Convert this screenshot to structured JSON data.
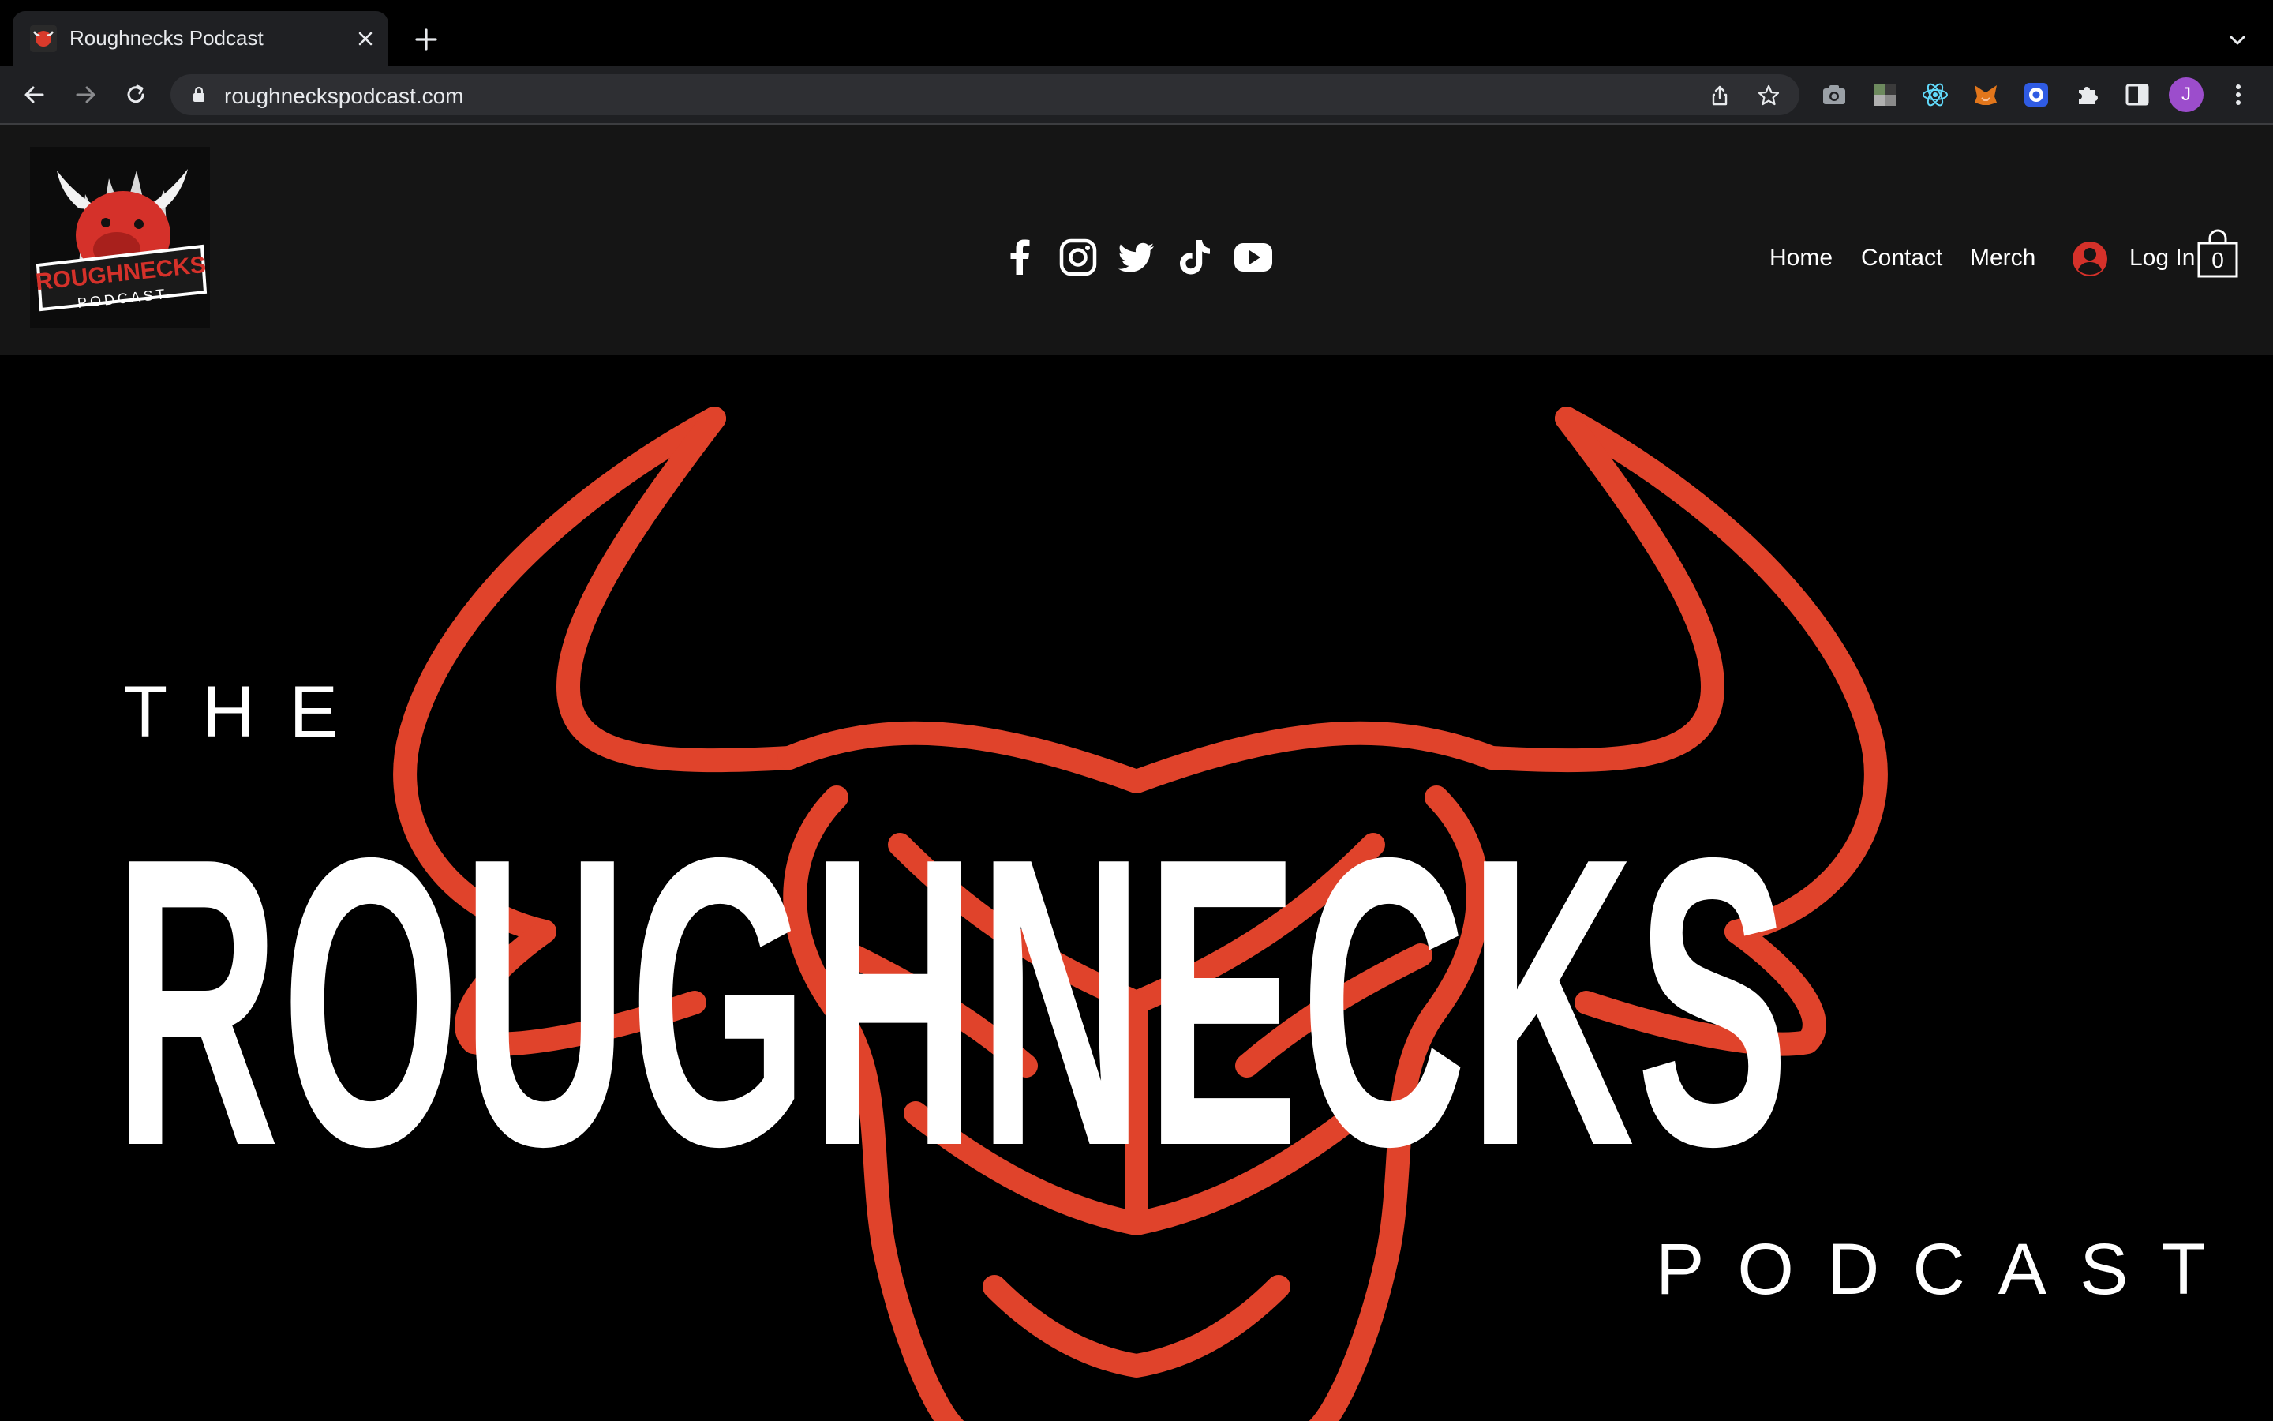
{
  "browser": {
    "tab_title": "Roughnecks Podcast",
    "url": "roughneckspodcast.com",
    "profile_initial": "J",
    "icons": [
      "back-icon",
      "forward-icon",
      "reload-icon",
      "lock-icon",
      "share-icon",
      "star-icon",
      "camera-icon",
      "extension-icon",
      "react-icon",
      "metamask-icon",
      "circle-extension-icon",
      "puzzle-icon",
      "sidebar-icon",
      "kebab-menu-icon"
    ]
  },
  "site": {
    "nav": [
      "Home",
      "Contact",
      "Merch"
    ],
    "login_label": "Log In",
    "cart_count": "0",
    "social": [
      "facebook-icon",
      "instagram-icon",
      "twitter-icon",
      "tiktok-icon",
      "youtube-icon"
    ],
    "logo_text": "ROUGHNECKS PODCAST"
  },
  "hero": {
    "the": "THE",
    "title": "ROUGHNECKS",
    "podcast": "PODCAST"
  },
  "colors": {
    "accent_red": "#e0432b",
    "header_bg": "#151515",
    "chrome_bg": "#1f2023"
  }
}
